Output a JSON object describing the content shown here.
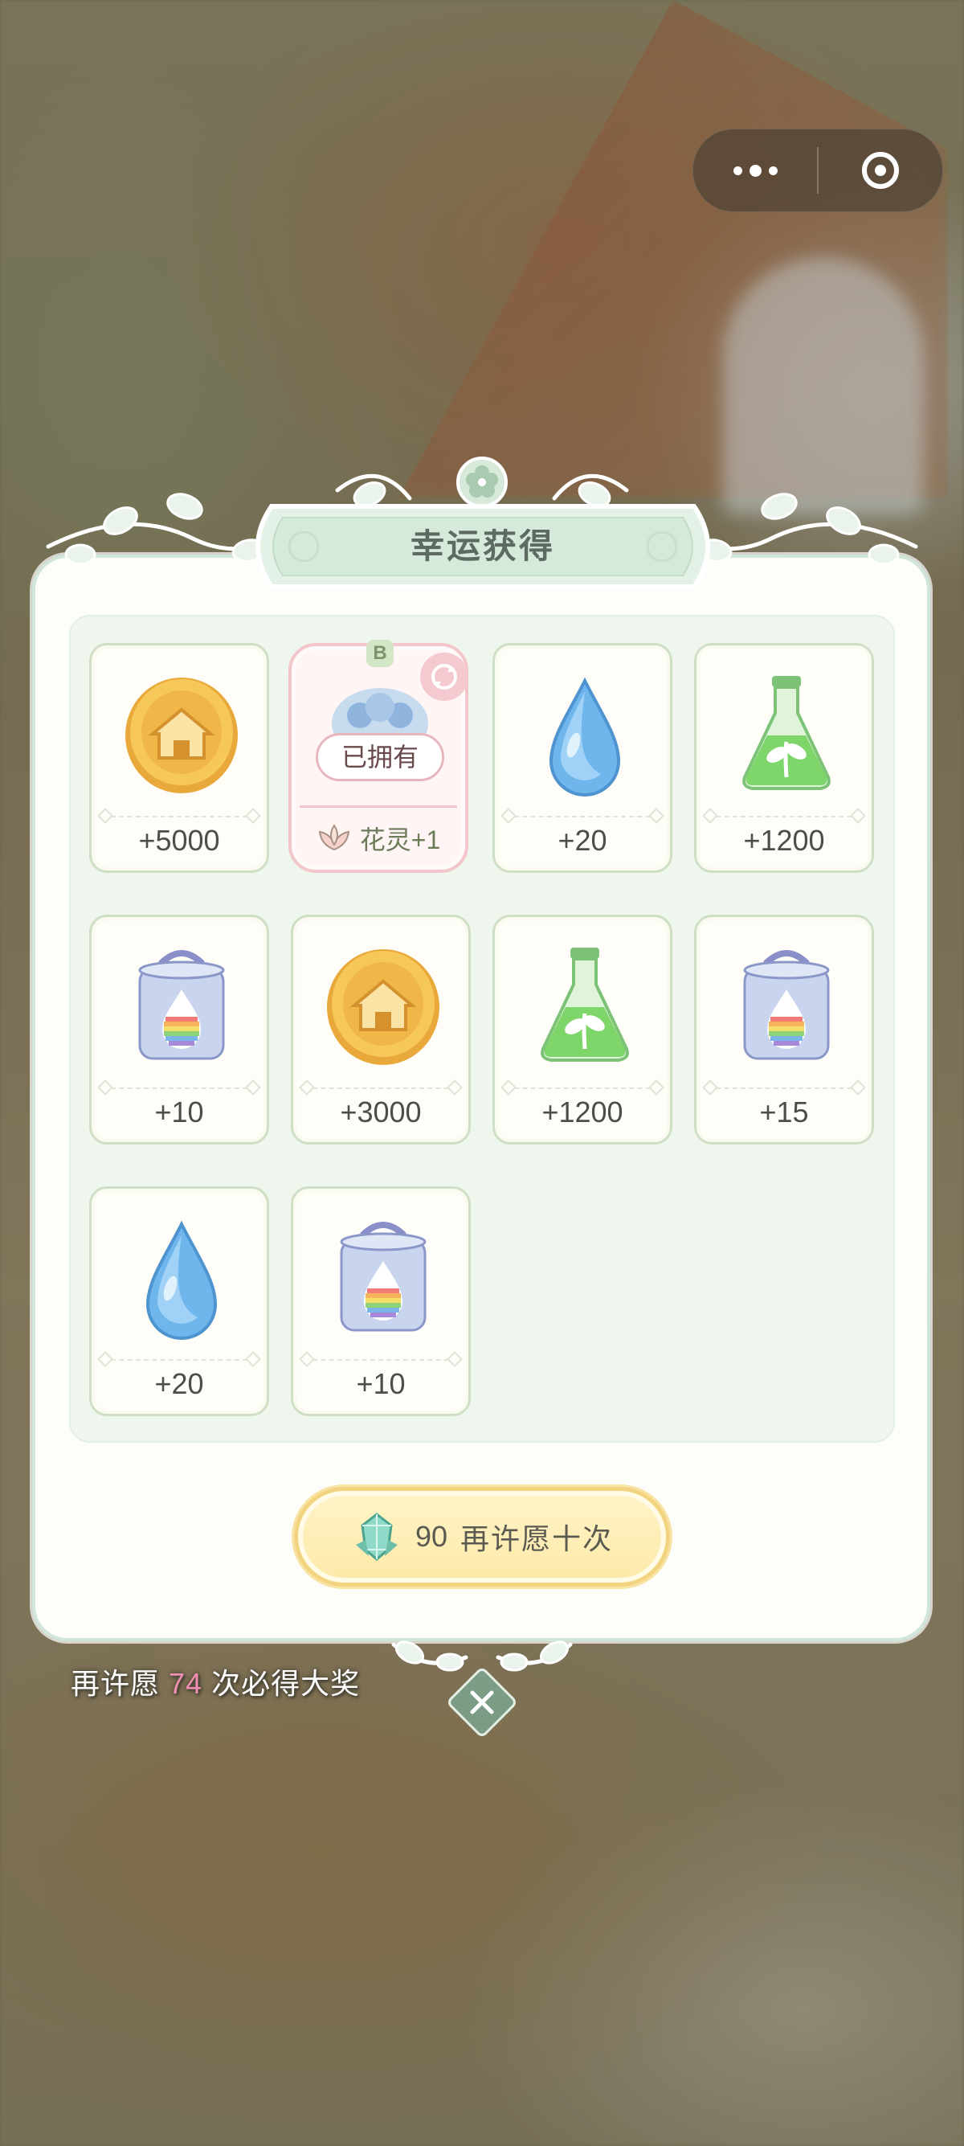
{
  "capsule": {
    "menu_icon": "more-dots-icon",
    "close_icon": "target-circle-icon"
  },
  "dialog": {
    "title": "幸运获得"
  },
  "rewards": [
    {
      "icon": "gold-house-coin-icon",
      "amount": "+5000"
    },
    {
      "icon": "flower-spirit-icon",
      "rarity": "B",
      "status": "已拥有",
      "spirit_label": "花灵+1",
      "special": true
    },
    {
      "icon": "water-drop-icon",
      "amount": "+20"
    },
    {
      "icon": "green-potion-flask-icon",
      "amount": "+1200"
    },
    {
      "icon": "rainbow-dye-bucket-icon",
      "amount": "+10"
    },
    {
      "icon": "gold-house-coin-icon",
      "amount": "+3000"
    },
    {
      "icon": "green-potion-flask-icon",
      "amount": "+1200"
    },
    {
      "icon": "rainbow-dye-bucket-icon",
      "amount": "+15"
    },
    {
      "icon": "water-drop-icon",
      "amount": "+20"
    },
    {
      "icon": "rainbow-dye-bucket-icon",
      "amount": "+10"
    }
  ],
  "wish_button": {
    "cost": "90",
    "label": "再许愿十次",
    "icon": "crystal-gem-icon"
  },
  "pity_tip": {
    "prefix": "再许愿",
    "count": "74",
    "suffix": "次必得大奖"
  },
  "colors": {
    "accent_pink": "#f08fb2",
    "panel_border": "#cfe6d8",
    "button_gold": "#f2d480"
  }
}
